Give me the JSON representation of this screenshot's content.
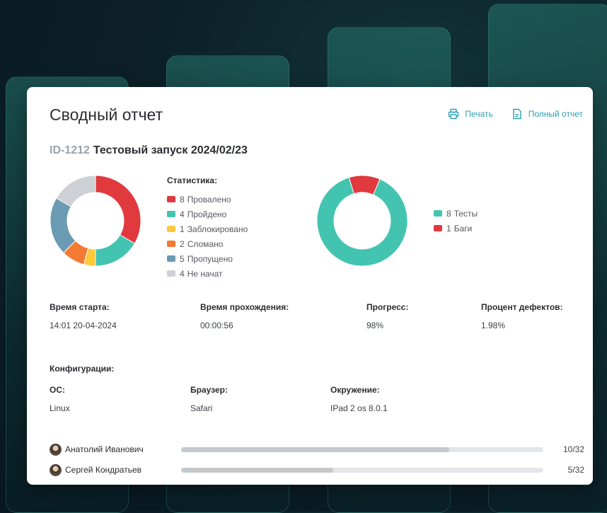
{
  "report": {
    "title": "Сводный отчет",
    "actions": {
      "print": "Печать",
      "full_report": "Полный отчет"
    },
    "run_id": "ID-1212",
    "run_name": "Тестовый запуск 2024/02/23"
  },
  "statistics": {
    "title": "Статистика:",
    "items": [
      {
        "count": "8",
        "label": "Провалено",
        "color": "#e0393e"
      },
      {
        "count": "4",
        "label": "Пройдено",
        "color": "#43c4b0"
      },
      {
        "count": "1",
        "label": "Заблокировано",
        "color": "#fdc93a"
      },
      {
        "count": "2",
        "label": "Сломано",
        "color": "#f47a33"
      },
      {
        "count": "5",
        "label": "Пропущено",
        "color": "#6a9bb2"
      },
      {
        "count": "4",
        "label": "Не начат",
        "color": "#cdd0d4"
      }
    ]
  },
  "tests_chart": {
    "items": [
      {
        "count": "8",
        "label": "Тесты",
        "color": "#43c4b0"
      },
      {
        "count": "1",
        "label": "Баги",
        "color": "#e0393e"
      }
    ]
  },
  "meta": {
    "start_label": "Время старта:",
    "start_value": "14:01  20-04-2024",
    "duration_label": "Время прохождения:",
    "duration_value": "00:00:56",
    "progress_label": "Прогресс:",
    "progress_value": "98%",
    "defects_label": "Процент дефектов:",
    "defects_value": "1.98%"
  },
  "config": {
    "title": "Конфигурации:",
    "os_label": "ОС:",
    "os_value": "Linux",
    "browser_label": "Браузер:",
    "browser_value": "Safari",
    "env_label": "Окружение:",
    "env_value": "IPad 2 os 8.0.1"
  },
  "users": [
    {
      "name": "Анатолий Иванович",
      "count": "10/32",
      "progress": 0.74
    },
    {
      "name": "Сергей Кондратьев",
      "count": "5/32",
      "progress": 0.42
    }
  ]
}
